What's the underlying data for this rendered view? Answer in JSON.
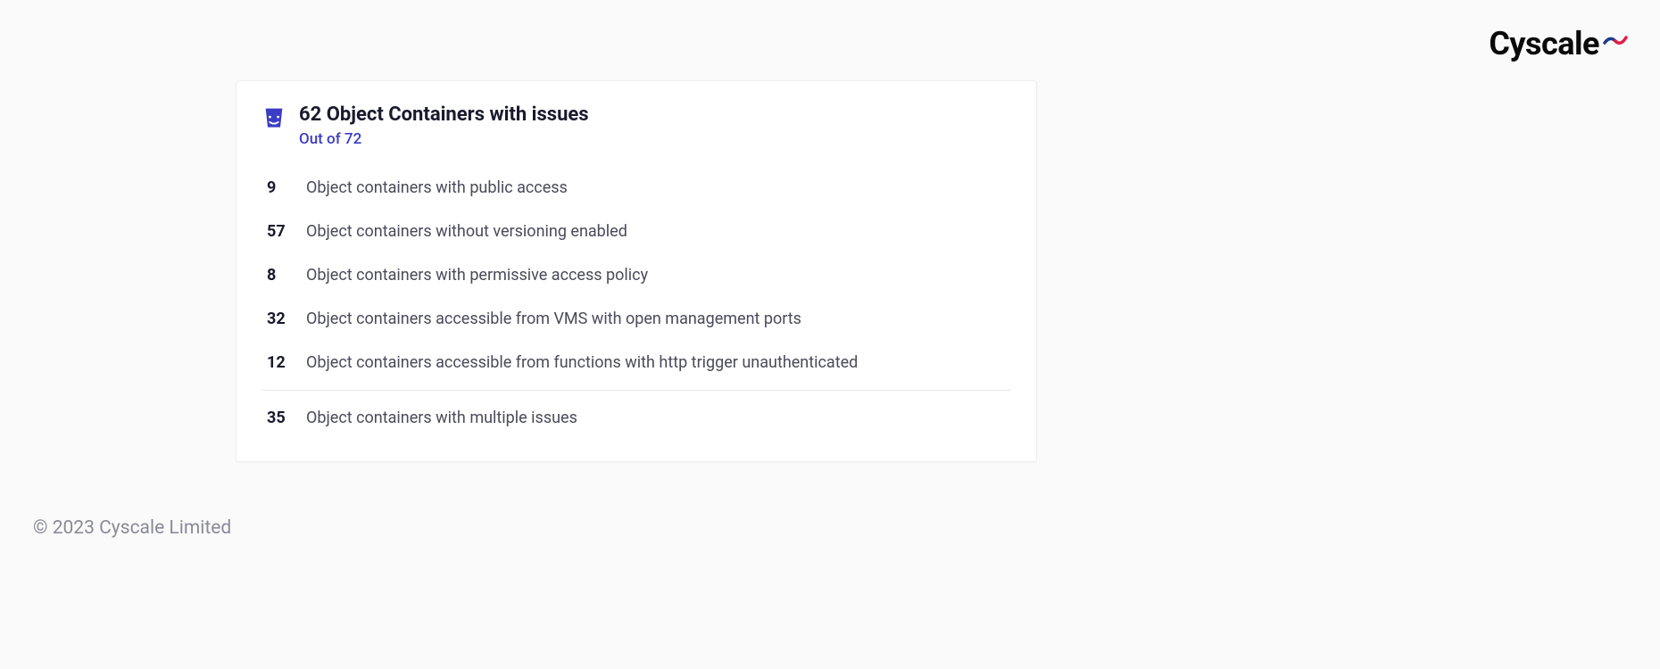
{
  "brand": {
    "name": "Cyscale"
  },
  "card": {
    "title": "62 Object Containers with issues",
    "subtitle": "Out of 72",
    "issues": [
      {
        "count": "9",
        "label": "Object containers with public access"
      },
      {
        "count": "57",
        "label": "Object containers without versioning enabled"
      },
      {
        "count": "8",
        "label": "Object containers with permissive access policy"
      },
      {
        "count": "32",
        "label": "Object containers accessible from VMS with open management ports"
      },
      {
        "count": "12",
        "label": "Object containers accessible from functions with http trigger unauthenticated"
      }
    ],
    "summary": {
      "count": "35",
      "label": "Object containers with multiple issues"
    }
  },
  "footer": {
    "copyright": "© 2023 Cyscale Limited"
  }
}
